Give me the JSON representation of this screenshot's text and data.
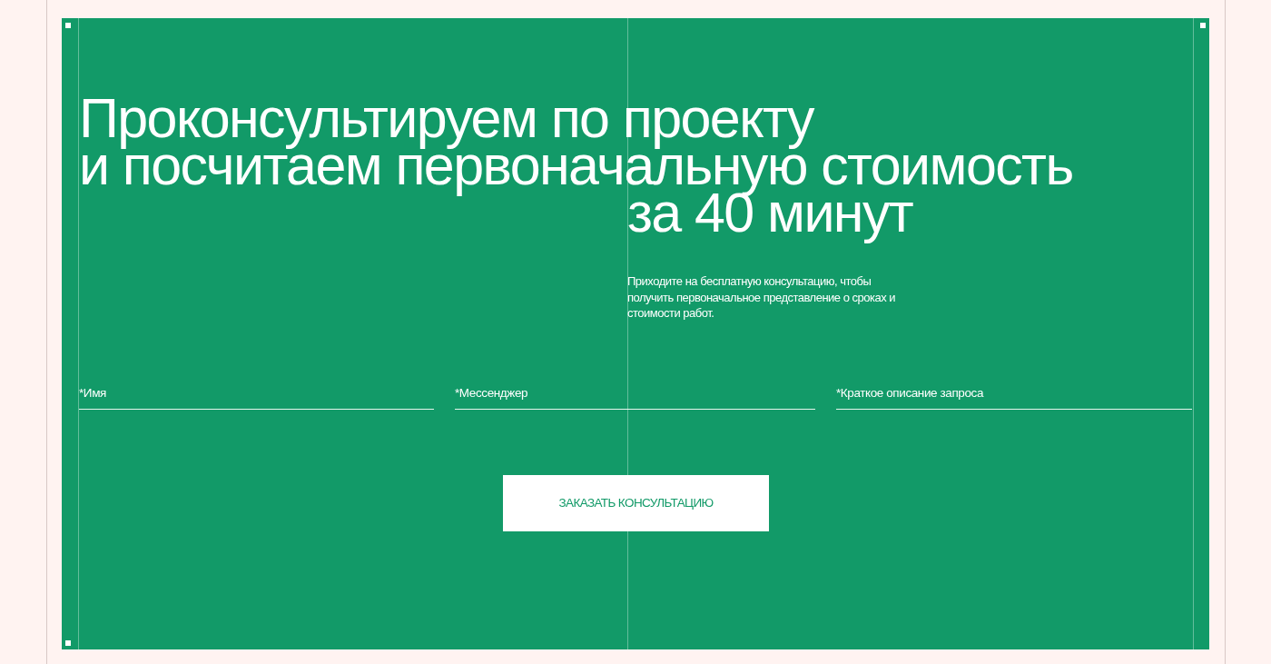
{
  "heading": {
    "lines": [
      {
        "text": "Проконсультируем по проекту",
        "kind": "left"
      },
      {
        "text": "и посчитаем первоначальную стоимость",
        "kind": "left"
      },
      {
        "text": "за 40 минут",
        "kind": "offset"
      }
    ]
  },
  "description": "Приходите на бесплатную консультацию, чтобы получить первоначальное представление о сроках и стоимости работ.",
  "fields": [
    {
      "placeholder": "*Имя"
    },
    {
      "placeholder": "*Мессенджер"
    },
    {
      "placeholder": "*Краткое описание запроса"
    }
  ],
  "submit_button": "ЗАКАЗАТЬ КОНСУЛЬТАЦИЮ"
}
